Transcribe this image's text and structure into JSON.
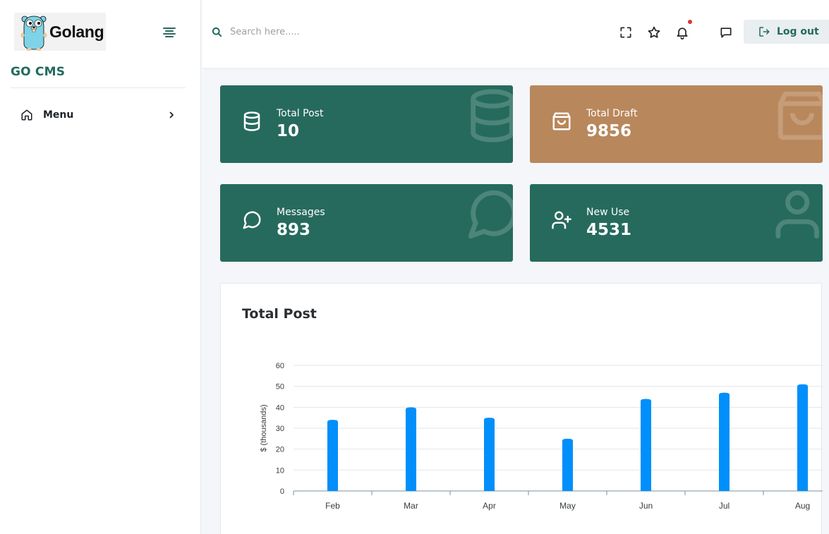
{
  "sidebar": {
    "logo_text": "Golang",
    "brand_title": "GO CMS",
    "menu": [
      {
        "label": "Menu",
        "icon": "home-icon"
      }
    ]
  },
  "header": {
    "search": {
      "placeholder": "Search here.....",
      "value": ""
    },
    "icons": [
      "fullscreen-icon",
      "star-icon",
      "bell-icon",
      "message-icon"
    ],
    "logout_label": "Log out"
  },
  "cards": [
    {
      "label": "Total Post",
      "value": "10",
      "icon": "database-icon",
      "color": "#266a5e"
    },
    {
      "label": "Total Draft",
      "value": "9856",
      "icon": "shopping-bag-icon",
      "color": "#b9875c"
    },
    {
      "label": "Messages",
      "value": "893",
      "icon": "message-circle-icon",
      "color": "#266a5e"
    },
    {
      "label": "New Use",
      "value": "4531",
      "icon": "user-plus-icon",
      "color": "#266a5e"
    }
  ],
  "chart_panel": {
    "title": "Total Post"
  },
  "chart_data": {
    "type": "bar",
    "categories": [
      "Feb",
      "Mar",
      "Apr",
      "May",
      "Jun",
      "Jul",
      "Aug"
    ],
    "series": [
      {
        "values": [
          34,
          40,
          35,
          25,
          44,
          47,
          51
        ]
      }
    ],
    "ylabel": "$ (thousands)",
    "xlabel": "",
    "ylim": [
      0,
      60
    ],
    "yticks": [
      0,
      10,
      20,
      30,
      40,
      50,
      60
    ],
    "grid": true,
    "bar_color": "#008ffb"
  }
}
